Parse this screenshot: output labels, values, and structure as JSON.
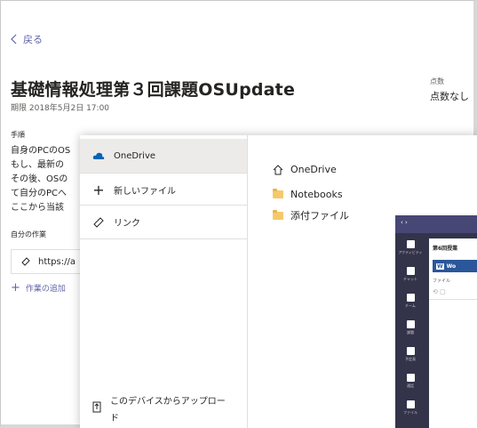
{
  "nav": {
    "back_label": "戻る"
  },
  "assignment": {
    "title": "基礎情報処理第３回課題OSUpdate",
    "due": "期限 2018年5月2日 17:00",
    "points_label": "点数",
    "points_value": "点数なし",
    "instructions_heading": "手順",
    "instructions_lines": [
      "自身のPCのOS",
      "もし、最新の",
      "その後、OSの",
      "て自分のPCへ",
      "ここから当該"
    ],
    "my_work_heading": "自分の作業",
    "work_link": "https://a",
    "add_work_label": "作業の追加"
  },
  "picker": {
    "left_items": [
      {
        "label": "OneDrive",
        "icon": "cloud-icon",
        "selected": true
      },
      {
        "label": "新しいファイル",
        "icon": "plus-icon"
      },
      {
        "label": "リンク",
        "icon": "link-icon"
      }
    ],
    "upload_label_1": "このデバイスからアップロー",
    "upload_label_2": "ド",
    "right": {
      "root": "OneDrive",
      "folders": [
        "Notebooks",
        "添付ファイル"
      ]
    }
  },
  "thumbnail": {
    "title": "第6回授業",
    "word_label": "Wo",
    "file_label": "ファイル",
    "rail": [
      "アクティビティ",
      "チャット",
      "チーム",
      "課題",
      "予定表",
      "通話",
      "ファイル"
    ]
  },
  "colors": {
    "accent": "#6264a7",
    "onedrive": "#0364b8",
    "folder": "#f5c96b",
    "teams_dark": "#33344a"
  }
}
